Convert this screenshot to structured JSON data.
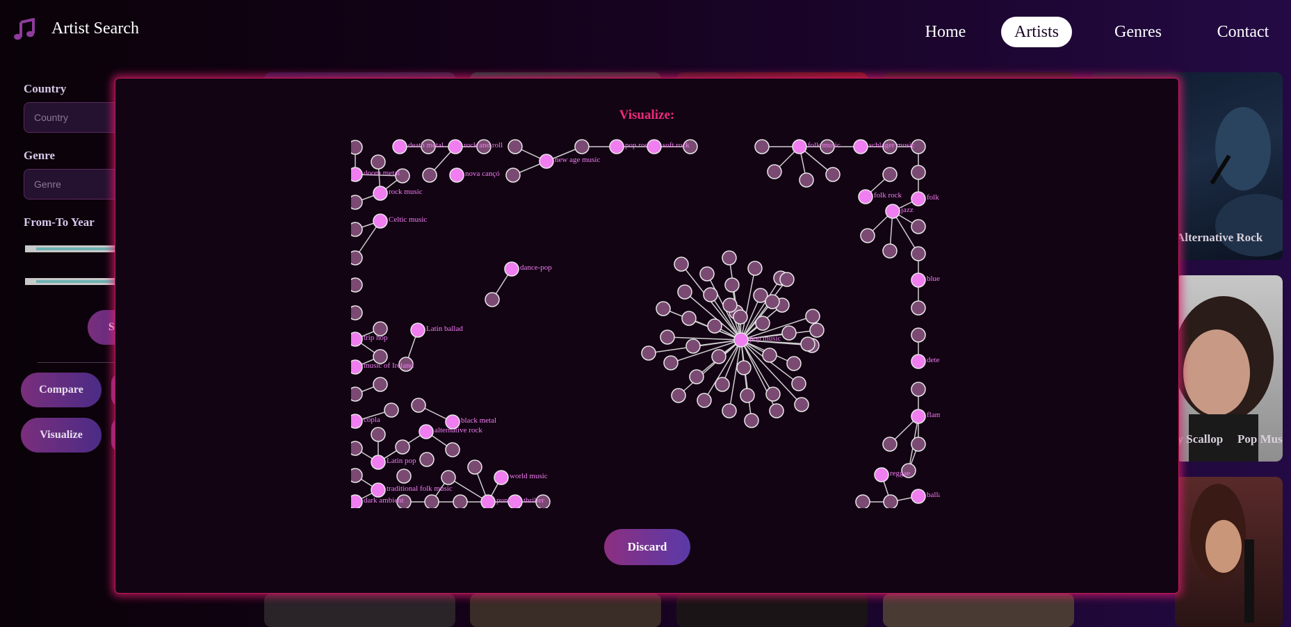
{
  "app": {
    "title": "Artist Search",
    "logo_icon": "music-note-icon"
  },
  "nav": [
    {
      "label": "Home",
      "active": false
    },
    {
      "label": "Artists",
      "active": true
    },
    {
      "label": "Genres",
      "active": false
    },
    {
      "label": "Contact",
      "active": false
    }
  ],
  "sidebar": {
    "country_label": "Country",
    "country_placeholder": "Country",
    "genre_label": "Genre",
    "genre_placeholder": "Genre",
    "year_label": "From-To Year",
    "search_label_partial": "S",
    "compare_label": "Compare",
    "visualize_label": "Visualize"
  },
  "cards": {
    "label_1": "Alternative Rock",
    "label_2_partial": "ry Scallop",
    "label_3": "Pop Music"
  },
  "modal": {
    "title": "Visualize:",
    "discard_label": "Discard",
    "graph_labels": {
      "death_metal": "death metal",
      "rock_and_roll": "rock and roll",
      "doom_metal": "doom metal",
      "nova_canco": "nova cançó",
      "new_age_music": "new age music",
      "pop_rock": "pop rock",
      "soft_rock": "soft rock",
      "rock_music": "rock music",
      "celtic_music": "Celtic music",
      "dance_pop": "dance-pop",
      "latin_ballad": "Latin ballad",
      "trip_hop": "trip hop",
      "music_of_ireland": "music of Ireland",
      "copla": "copla",
      "black_metal": "black metal",
      "alternative_rock": "alternative rock",
      "latin_pop": "Latin pop",
      "world_music": "world music",
      "traditional_folk_music": "traditional folk music",
      "dark_ambient": "dark ambient",
      "punk": "punk",
      "thriller": "thriller",
      "folk_music": "folk music",
      "schlager_music": "schlager music",
      "folk_rock": "folk rock",
      "folk_partial": "folk r",
      "jazz": "jazz",
      "blues_partial": "blues",
      "detect_partial": "detec",
      "flame_partial": "flame",
      "reggae": "reggae",
      "ballad_partial": "balla",
      "pop_music_partial": "pop music"
    }
  },
  "colors": {
    "accent": "#ec2a7a",
    "node_highlight": "#f07ef0",
    "node_default": "#7a4a72",
    "modal_bg": "#130414",
    "modal_border": "#c2185b"
  }
}
